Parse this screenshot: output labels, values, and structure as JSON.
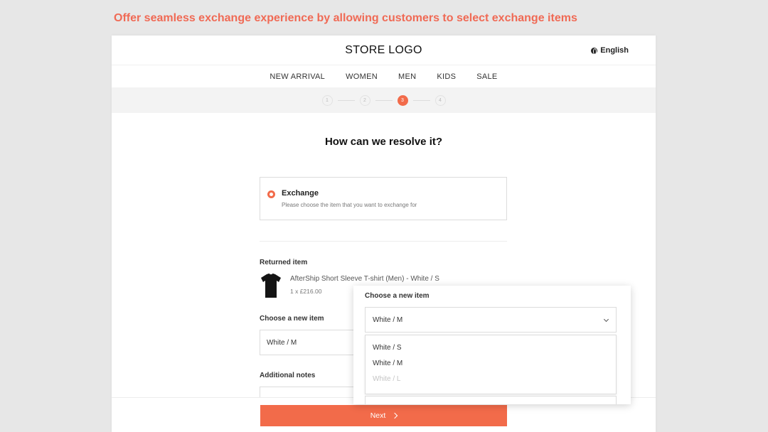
{
  "caption": "Offer seamless exchange experience by allowing customers to select exchange items",
  "header": {
    "logo": "STORE LOGO",
    "language": "English"
  },
  "nav": {
    "items": [
      "NEW ARRIVAL",
      "WOMEN",
      "MEN",
      "KIDS",
      "SALE"
    ]
  },
  "stepper": {
    "steps": [
      "1",
      "2",
      "3",
      "4"
    ],
    "active_step": 3
  },
  "main": {
    "heading": "How can we resolve it?",
    "option": {
      "title": "Exchange",
      "description": "Please choose the item that you want to exchange for"
    },
    "returned_item": {
      "label": "Returned item",
      "name": "AfterShip Short Sleeve T-shirt (Men) - White / S",
      "quantity_price": "1 x £216.00"
    },
    "choose_label": "Choose a new item",
    "choose_value": "White / M",
    "notes_label": "Additional notes",
    "next_label": "Next"
  },
  "popup": {
    "title": "Choose a new item",
    "selected": "White / M",
    "options": [
      {
        "label": "White / S",
        "disabled": false
      },
      {
        "label": "White / M",
        "disabled": false
      },
      {
        "label": "White / L",
        "disabled": true
      }
    ]
  },
  "colors": {
    "accent": "#f26b4a",
    "caption": "#f06a55",
    "background": "#e7e7e7"
  }
}
